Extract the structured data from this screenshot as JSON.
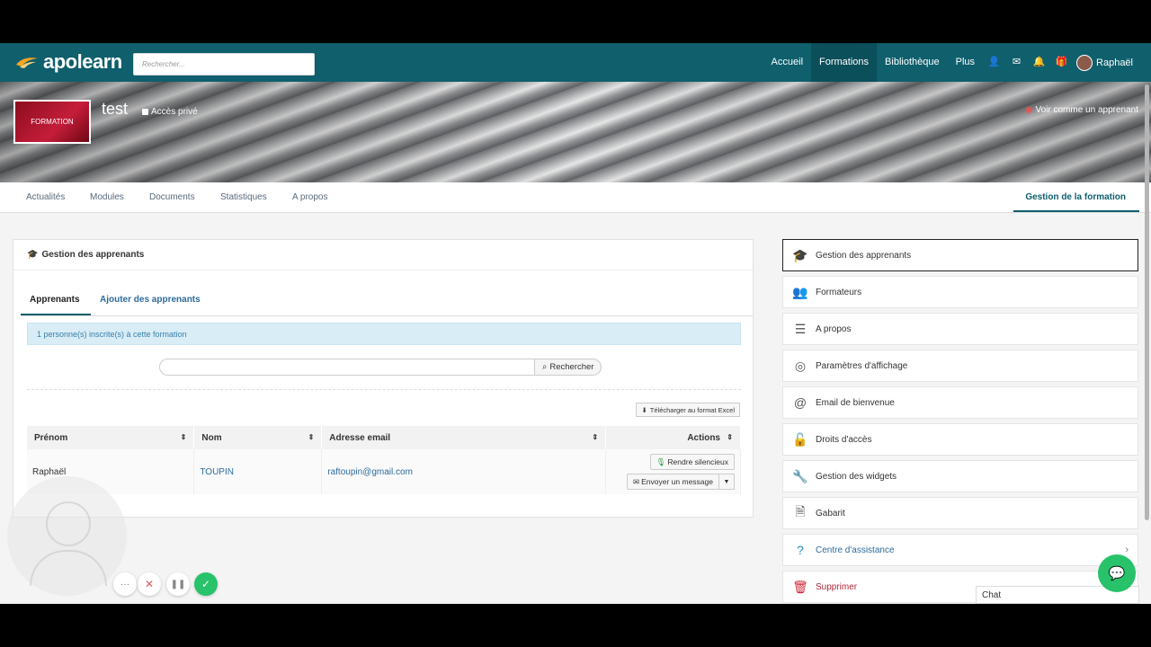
{
  "nav": {
    "logo": "apolearn",
    "search_placeholder": "Rechercher...",
    "items": [
      "Accueil",
      "Formations",
      "Bibliothèque",
      "Plus"
    ],
    "user": "Raphaël"
  },
  "banner": {
    "thumb_label": "FORMATION",
    "title": "test",
    "access": "Accès privé",
    "view_as": "Voir comme un apprenant"
  },
  "tabs": [
    "Actualités",
    "Modules",
    "Documents",
    "Statistiques",
    "A propos"
  ],
  "tab_right": "Gestion de la formation",
  "panel": {
    "title": "Gestion des apprenants",
    "subtabs": [
      "Apprenants",
      "Ajouter des apprenants"
    ],
    "info": "1 personne(s) inscrite(s) à cette formation",
    "search_btn": "Rechercher",
    "excel_btn": "Télécharger au format Excel",
    "columns": [
      "Prénom",
      "Nom",
      "Adresse email",
      "Actions"
    ],
    "rows": [
      {
        "prenom": "Raphaël",
        "nom": "TOUPIN",
        "email": "raftoupin@gmail.com"
      }
    ],
    "action_mute": "Rendre silencieux",
    "action_message": "Envoyer un message"
  },
  "sidebar": [
    {
      "label": "Gestion des apprenants",
      "icon": "graduation-cap-icon"
    },
    {
      "label": "Formateurs",
      "icon": "users-icon"
    },
    {
      "label": "A propos",
      "icon": "list-icon"
    },
    {
      "label": "Paramètres d'affichage",
      "icon": "eye-slash-icon"
    },
    {
      "label": "Email de bienvenue",
      "icon": "at-icon"
    },
    {
      "label": "Droits d'accès",
      "icon": "lock-icon"
    },
    {
      "label": "Gestion des widgets",
      "icon": "wrench-icon"
    },
    {
      "label": "Gabarit",
      "icon": "file-icon"
    },
    {
      "label": "Centre d'assistance",
      "icon": "question-icon"
    },
    {
      "label": "Supprimer",
      "icon": "trash-icon"
    }
  ],
  "chat": "Chat",
  "colors": {
    "primary": "#0f5f6d",
    "link": "#2d6b9c",
    "danger": "#b0283a",
    "chat": "#27c26a"
  }
}
